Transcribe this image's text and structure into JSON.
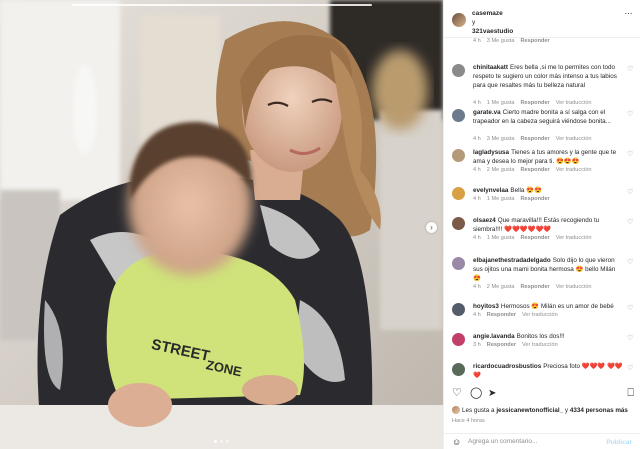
{
  "header": {
    "users": [
      "casemaze",
      "y",
      "321vaestudio"
    ],
    "more_icon": "⋯"
  },
  "comments": [
    {
      "user": "",
      "text": "",
      "time": "4 h",
      "likes": "3 Me gusta",
      "reply": "Responder",
      "translate": "",
      "avatar": "#c8b8a0"
    },
    {
      "user": "chinitaakatt",
      "text": "Eres bella ,si me lo permites con todo respeto te sugiero un color más intenso a tus labios para que resaltes más tu belleza natural",
      "time": "4 h",
      "likes": "1 Me gusta",
      "reply": "Responder",
      "translate": "Ver traducción",
      "avatar": "#8a8a8a"
    },
    {
      "user": "garate.va",
      "text": "Cierto madre bonita a sí salga con el trapeador en la cabeza seguirá viéndose bonita...",
      "time": "4 h",
      "likes": "3 Me gusta",
      "reply": "Responder",
      "translate": "Ver traducción",
      "avatar": "#6c7a8c"
    },
    {
      "user": "lagladysusa",
      "text": "Tienes a tus amores y la gente que te ama y desea lo mejor para ti. 😍😍😍",
      "time": "4 h",
      "likes": "2 Me gusta",
      "reply": "Responder",
      "translate": "Ver traducción",
      "avatar": "#b59a7a"
    },
    {
      "user": "evelynvelaa",
      "text": "Bella 😍😍",
      "time": "4 h",
      "likes": "1 Me gusta",
      "reply": "Responder",
      "translate": "",
      "avatar": "#d6a043"
    },
    {
      "user": "olsaez4",
      "text": "Que maravilla!!! Estás recogiendo tu siembra!!!! ❤️❤️❤️❤️❤️❤️",
      "time": "4 h",
      "likes": "1 Me gusta",
      "reply": "Responder",
      "translate": "Ver traducción",
      "avatar": "#7b5a4a"
    },
    {
      "user": "elbajanethestradadelgado",
      "text": "Solo dijo lo que vieron sus ojitos una mami bonita hermosa 😍 bello Milán 😍",
      "time": "4 h",
      "likes": "2 Me gusta",
      "reply": "Responder",
      "translate": "Ver traducción",
      "avatar": "#9a8aa8"
    },
    {
      "user": "hoyitos3",
      "text": "Hermosos 😍 Milán es un amor de bebé",
      "time": "4 h",
      "likes": "",
      "reply": "Responder",
      "translate": "Ver traducción",
      "avatar": "#555d6a"
    },
    {
      "user": "angie.lavanda",
      "text": "Bonitos los dos!!!",
      "time": "3 h",
      "likes": "",
      "reply": "Responder",
      "translate": "Ver traducción",
      "avatar": "#c0406a"
    },
    {
      "user": "ricardocuadrosbustios",
      "text": "Preciosa foto ❤️❤️❤️ ❤️❤️❤️",
      "time": "3 h",
      "likes": "",
      "reply": "Responder",
      "translate": "",
      "avatar": "#5a6a5a"
    }
  ],
  "actions": {
    "like_icon": "♡",
    "comment_icon": "◯",
    "share_icon": "➤",
    "save_icon": "⎕"
  },
  "likes_text": {
    "prefix": "Les gusta a ",
    "user": "jessicanewtonofficial_",
    "middle": " y ",
    "count": "4334 personas más"
  },
  "post_time": "Hace 4 horas",
  "comment_box": {
    "emoji_icon": "☺",
    "placeholder": "Agrega un comentario...",
    "publish": "Publicar"
  },
  "photo": {
    "next_icon": "›"
  },
  "colors": {
    "meta": "#8e8e8e",
    "publish_disabled": "#b2dffc",
    "text": "#262626"
  }
}
